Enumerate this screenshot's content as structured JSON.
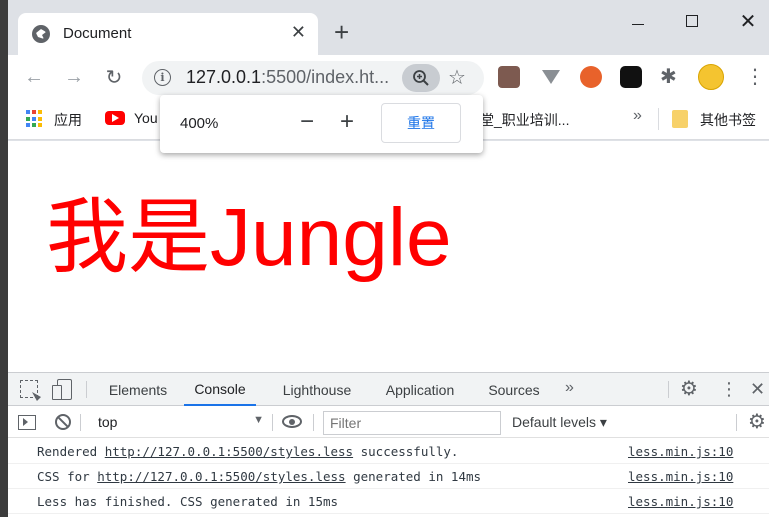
{
  "tab": {
    "title": "Document"
  },
  "toolbar": {
    "url_host": "127.0.0.1",
    "url_rest": ":5500/index.ht..."
  },
  "bookmarks": {
    "apps_label": "应用",
    "youtube_label": "You",
    "course_label": "课堂_职业培训...",
    "more_label": "»",
    "folder_label": "其他书签"
  },
  "zoom_popup": {
    "level": "400%",
    "minus": "−",
    "plus": "+",
    "reset_label": "重置"
  },
  "page": {
    "heading": "我是Jungle",
    "heading_color": "#ff0000"
  },
  "devtools": {
    "tabs": [
      "Elements",
      "Console",
      "Lighthouse",
      "Application",
      "Sources"
    ],
    "active_tab": "Console",
    "more_tabs": "»",
    "context": "top",
    "filter_placeholder": "Filter",
    "levels_label": "Default levels ▾",
    "lines": [
      {
        "pre": "Rendered ",
        "link": "http://127.0.0.1:5500/styles.less",
        "post": " successfully.",
        "source": "less.min.js:10"
      },
      {
        "pre": "CSS for ",
        "link": "http://127.0.0.1:5500/styles.less",
        "post": " generated in 14ms",
        "source": "less.min.js:10"
      },
      {
        "pre": "Less has finished. CSS generated in 15ms",
        "link": "",
        "post": "",
        "source": "less.min.js:10"
      }
    ]
  },
  "colors": {
    "accent": "#1a73e8",
    "tabstrip": "#dee1e6"
  }
}
